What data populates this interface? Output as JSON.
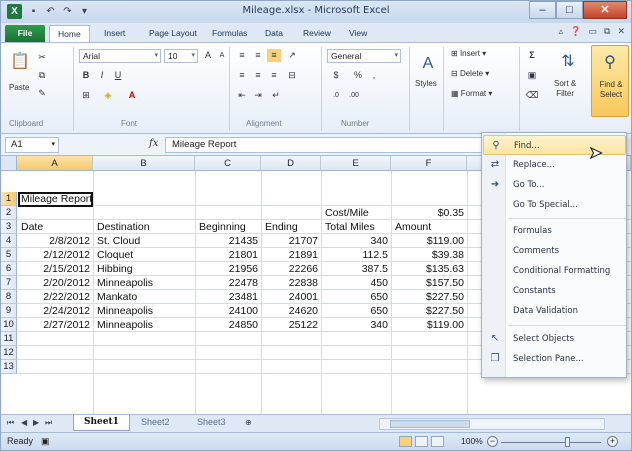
{
  "window": {
    "title": "Mileage.xlsx - Microsoft Excel",
    "app_icon": "X",
    "controls": [
      "minimize-icon",
      "maximize-icon",
      "close-icon"
    ]
  },
  "ribbon_tabs": [
    {
      "label": "File"
    },
    {
      "label": "Home"
    },
    {
      "label": "Insert"
    },
    {
      "label": "Page Layout"
    },
    {
      "label": "Formulas"
    },
    {
      "label": "Data"
    },
    {
      "label": "Review"
    },
    {
      "label": "View"
    }
  ],
  "ribbon": {
    "clipboard": {
      "label": "Clipboard",
      "paste": "Paste"
    },
    "font": {
      "label": "Font",
      "name": "Arial",
      "size": "10"
    },
    "alignment": {
      "label": "Alignment"
    },
    "number": {
      "label": "Number",
      "format": "General",
      "dollar": "$",
      "percent": "%",
      "comma": ","
    },
    "styles": {
      "label": "Styles"
    },
    "cells": {
      "insert": "Insert",
      "delete": "Delete",
      "format": "Format"
    },
    "editing": {
      "sort": "Sort &",
      "filter": "Filter",
      "find": "Find &",
      "select": "Select"
    }
  },
  "formula_bar": {
    "name_box": "A1",
    "fx": "fx",
    "content": "Mileage Report"
  },
  "columns": [
    "A",
    "B",
    "C",
    "D",
    "E",
    "F"
  ],
  "rows": [
    "1",
    "2",
    "3",
    "4",
    "5",
    "6",
    "7",
    "8",
    "9",
    "10",
    "11",
    "12",
    "13"
  ],
  "sheet": {
    "title": "Mileage Report",
    "cost_label": "Cost/Mile",
    "cost_value": "$0.35",
    "headers": [
      "Date",
      "Destination",
      "Beginning",
      "Ending",
      "Total Miles",
      "Amount"
    ],
    "data": [
      [
        "2/8/2012",
        "St. Cloud",
        "21435",
        "21707",
        "340",
        "$119.00"
      ],
      [
        "2/12/2012",
        "Cloquet",
        "21801",
        "21891",
        "112.5",
        "$39.38"
      ],
      [
        "2/15/2012",
        "Hibbing",
        "21956",
        "22266",
        "387.5",
        "$135.63"
      ],
      [
        "2/20/2012",
        "Minneapolis",
        "22478",
        "22838",
        "450",
        "$157.50"
      ],
      [
        "2/22/2012",
        "Mankato",
        "23481",
        "24001",
        "650",
        "$227.50"
      ],
      [
        "2/24/2012",
        "Minneapolis",
        "24100",
        "24620",
        "650",
        "$227.50"
      ],
      [
        "2/27/2012",
        "Minneapolis",
        "24850",
        "25122",
        "340",
        "$119.00"
      ]
    ]
  },
  "sheet_tabs": [
    "Sheet1",
    "Sheet2",
    "Sheet3"
  ],
  "status": {
    "ready": "Ready",
    "zoom": "100%"
  },
  "find_menu": {
    "items": [
      {
        "label": "Find...",
        "icon": "binoculars-icon"
      },
      {
        "label": "Replace...",
        "icon": "replace-icon"
      },
      {
        "label": "Go To...",
        "icon": "arrow-right-icon"
      },
      {
        "label": "Go To Special...",
        "icon": ""
      },
      {
        "label": "Formulas",
        "icon": ""
      },
      {
        "label": "Comments",
        "icon": ""
      },
      {
        "label": "Conditional Formatting",
        "icon": ""
      },
      {
        "label": "Constants",
        "icon": ""
      },
      {
        "label": "Data Validation",
        "icon": ""
      },
      {
        "label": "Select Objects",
        "icon": "pointer-icon"
      },
      {
        "label": "Selection Pane...",
        "icon": "selection-pane-icon"
      }
    ]
  }
}
